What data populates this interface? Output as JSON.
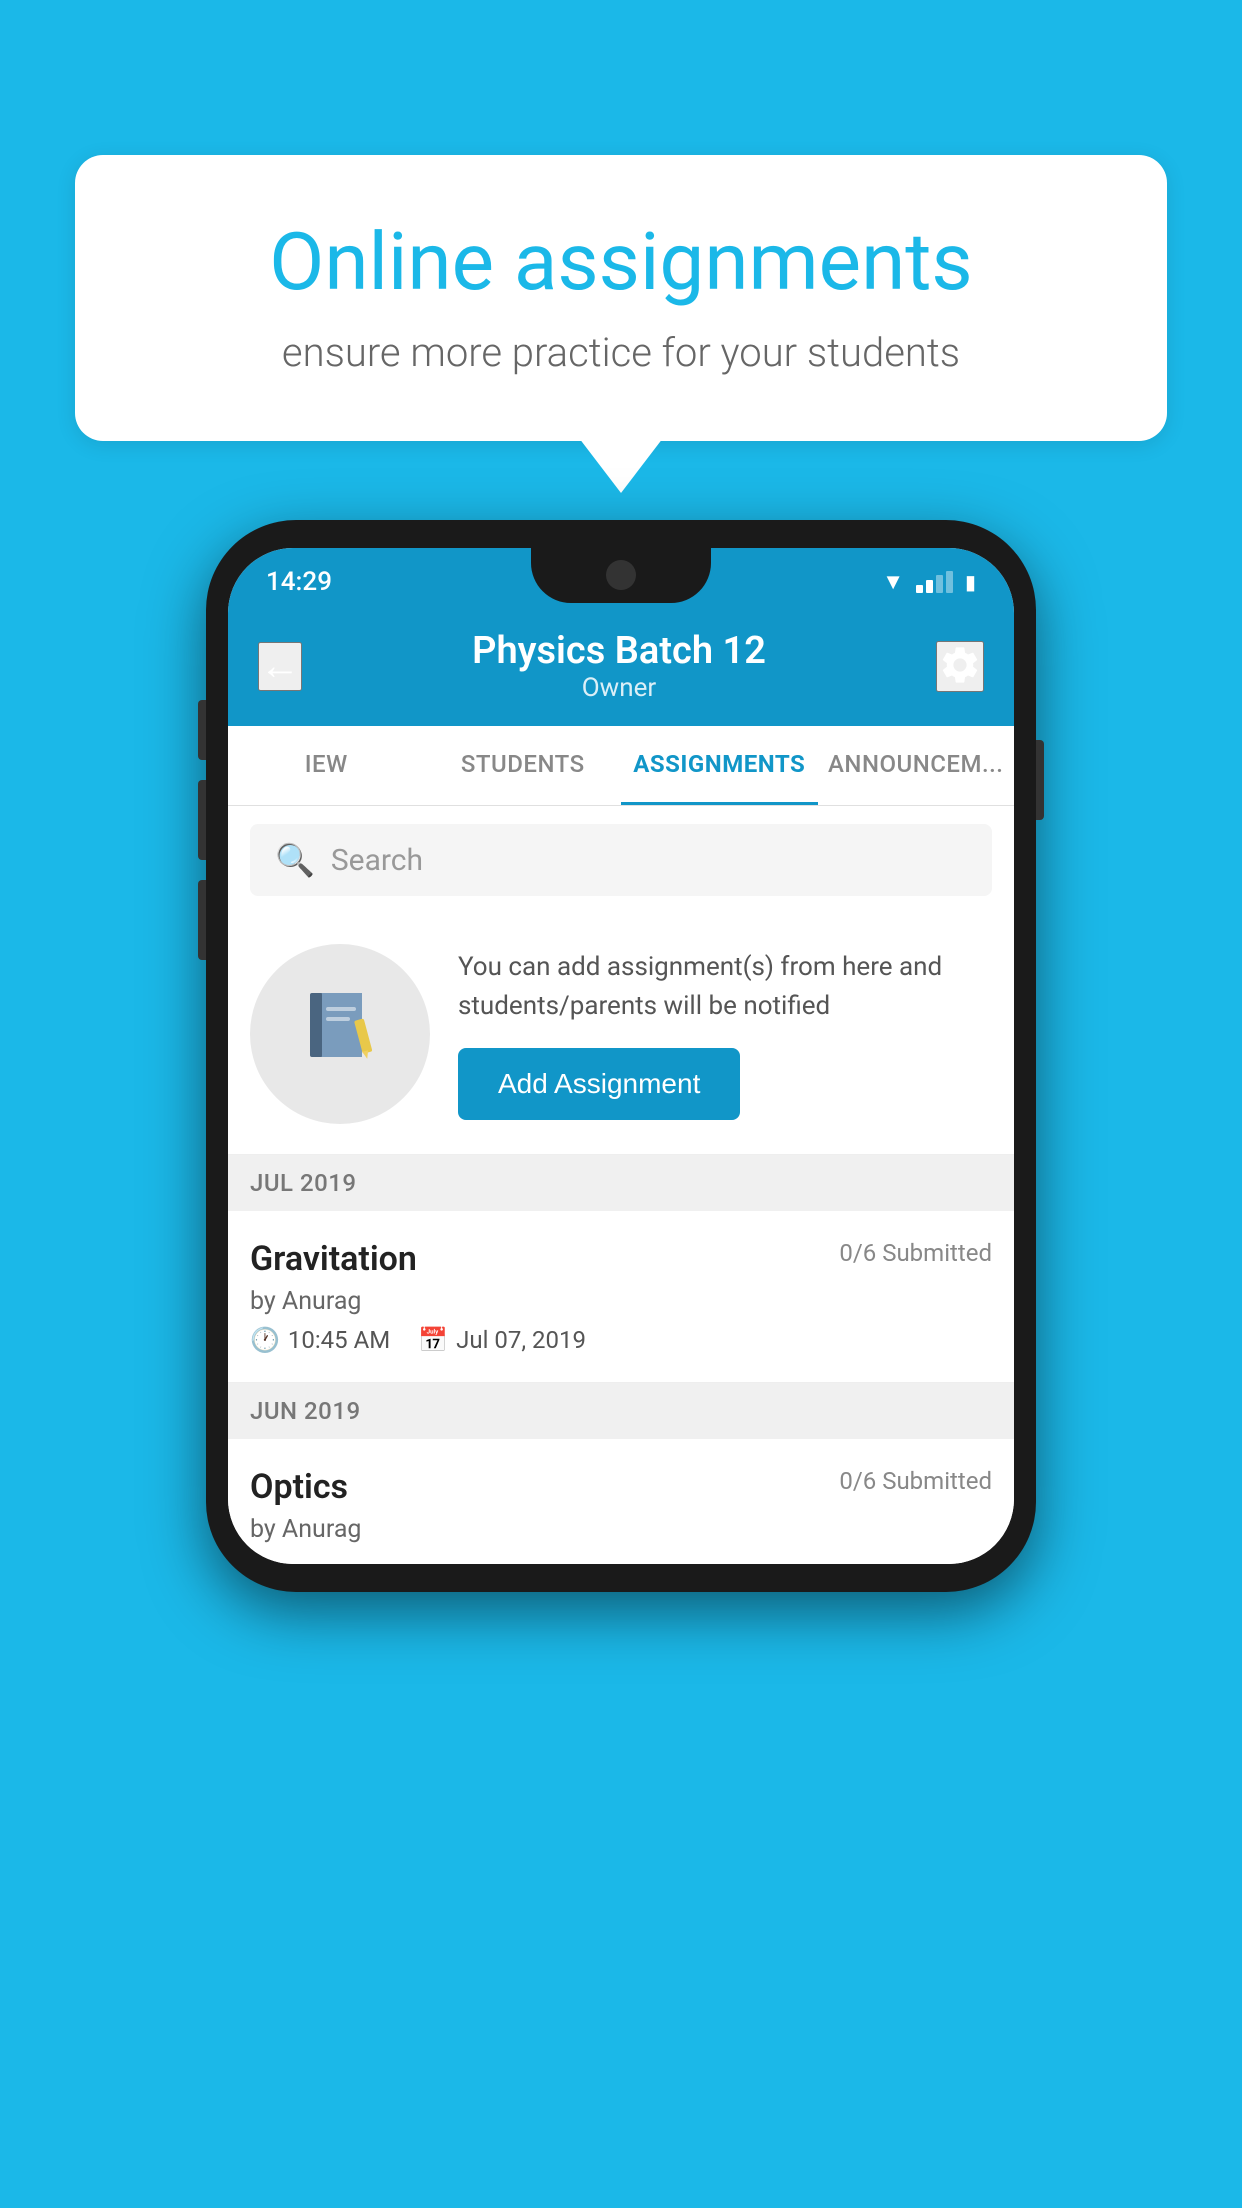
{
  "background_color": "#1BB8E8",
  "speech_bubble": {
    "title": "Online assignments",
    "subtitle": "ensure more practice for your students"
  },
  "status_bar": {
    "time": "14:29"
  },
  "app_bar": {
    "title": "Physics Batch 12",
    "subtitle": "Owner",
    "back_label": "←"
  },
  "tabs": [
    {
      "label": "IEW",
      "active": false
    },
    {
      "label": "STUDENTS",
      "active": false
    },
    {
      "label": "ASSIGNMENTS",
      "active": true
    },
    {
      "label": "ANNOUNCEM...",
      "active": false
    }
  ],
  "search": {
    "placeholder": "Search"
  },
  "promo": {
    "text": "You can add assignment(s) from here and students/parents will be notified",
    "button_label": "Add Assignment"
  },
  "sections": [
    {
      "month": "JUL 2019",
      "assignments": [
        {
          "name": "Gravitation",
          "submitted": "0/6 Submitted",
          "by": "by Anurag",
          "time": "10:45 AM",
          "date": "Jul 07, 2019"
        }
      ]
    },
    {
      "month": "JUN 2019",
      "assignments": [
        {
          "name": "Optics",
          "submitted": "0/6 Submitted",
          "by": "by Anurag",
          "time": "",
          "date": ""
        }
      ]
    }
  ],
  "icons": {
    "search": "🔍",
    "notebook": "📓",
    "clock": "🕐",
    "calendar": "📅",
    "settings": "⚙"
  }
}
